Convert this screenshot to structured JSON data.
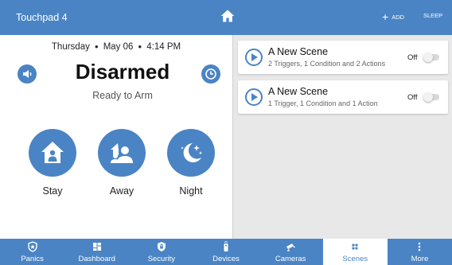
{
  "header": {
    "title": "Touchpad 4",
    "home_icon": "home-icon",
    "add_label": "ADD",
    "add_symbol": "+",
    "sleep_label": "SLEEP"
  },
  "security": {
    "day": "Thursday",
    "date": "May 06",
    "time": "4:14 PM",
    "separator": "●",
    "status": "Disarmed",
    "substatus": "Ready to Arm",
    "left_button_icon": "speaker-icon",
    "right_button_icon": "clock-icon",
    "arm_buttons": [
      {
        "label": "Stay",
        "icon": "home-person-icon"
      },
      {
        "label": "Away",
        "icon": "away-people-icon"
      },
      {
        "label": "Night",
        "icon": "moon-stars-icon"
      }
    ]
  },
  "scenes": [
    {
      "name": "A New Scene",
      "description": "2 Triggers, 1 Condition and 2 Actions",
      "state": "Off"
    },
    {
      "name": "A New Scene",
      "description": "1 Trigger, 1 Condition and 1 Action",
      "state": "Off"
    }
  ],
  "nav": {
    "active": "Scenes",
    "items": [
      {
        "label": "Panics",
        "icon": "shield-star-icon"
      },
      {
        "label": "Dashboard",
        "icon": "dashboard-icon"
      },
      {
        "label": "Security",
        "icon": "shield-lock-icon"
      },
      {
        "label": "Devices",
        "icon": "remote-icon"
      },
      {
        "label": "Cameras",
        "icon": "camera-icon"
      },
      {
        "label": "Scenes",
        "icon": "scenes-icon"
      },
      {
        "label": "More",
        "icon": "more-vertical-icon"
      }
    ]
  },
  "colors": {
    "primary": "#4a84c4",
    "panel_bg": "#e8e8e8",
    "active_tab_bg": "#ffffff"
  }
}
